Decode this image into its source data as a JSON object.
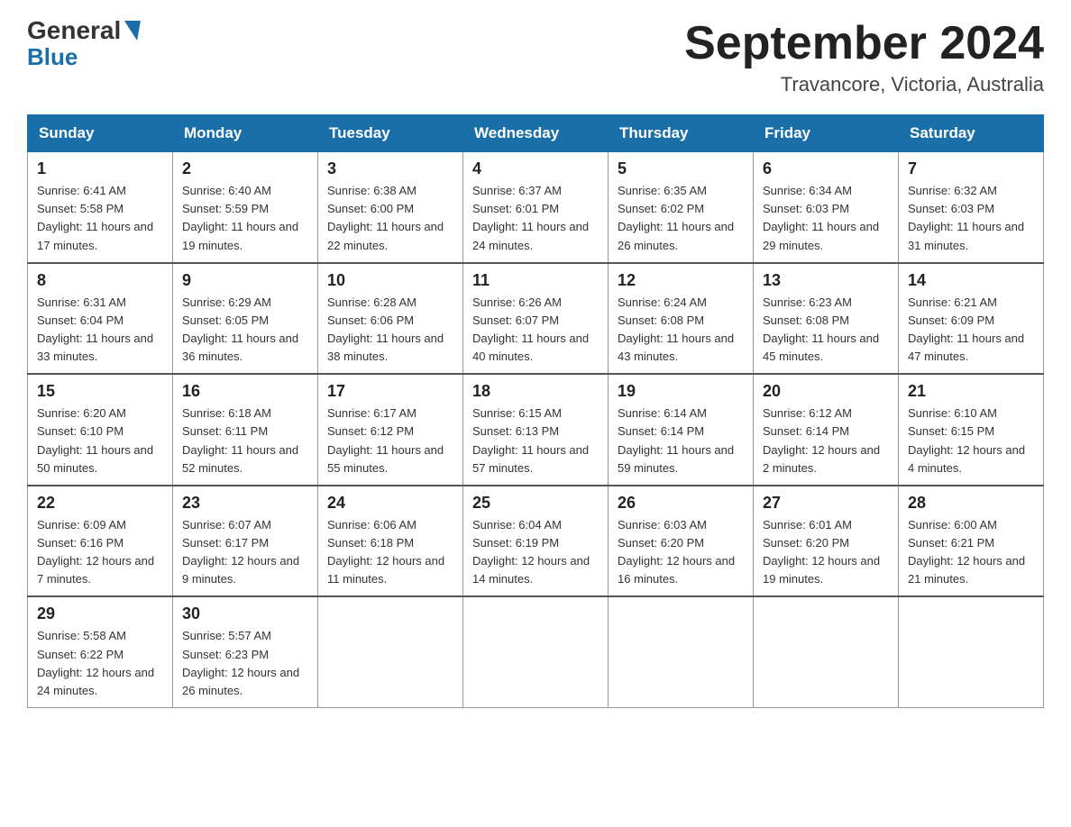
{
  "header": {
    "logo": {
      "general": "General",
      "blue": "Blue"
    },
    "title": "September 2024",
    "location": "Travancore, Victoria, Australia"
  },
  "weekdays": [
    "Sunday",
    "Monday",
    "Tuesday",
    "Wednesday",
    "Thursday",
    "Friday",
    "Saturday"
  ],
  "weeks": [
    [
      {
        "day": "1",
        "sunrise": "6:41 AM",
        "sunset": "5:58 PM",
        "daylight": "11 hours and 17 minutes."
      },
      {
        "day": "2",
        "sunrise": "6:40 AM",
        "sunset": "5:59 PM",
        "daylight": "11 hours and 19 minutes."
      },
      {
        "day": "3",
        "sunrise": "6:38 AM",
        "sunset": "6:00 PM",
        "daylight": "11 hours and 22 minutes."
      },
      {
        "day": "4",
        "sunrise": "6:37 AM",
        "sunset": "6:01 PM",
        "daylight": "11 hours and 24 minutes."
      },
      {
        "day": "5",
        "sunrise": "6:35 AM",
        "sunset": "6:02 PM",
        "daylight": "11 hours and 26 minutes."
      },
      {
        "day": "6",
        "sunrise": "6:34 AM",
        "sunset": "6:03 PM",
        "daylight": "11 hours and 29 minutes."
      },
      {
        "day": "7",
        "sunrise": "6:32 AM",
        "sunset": "6:03 PM",
        "daylight": "11 hours and 31 minutes."
      }
    ],
    [
      {
        "day": "8",
        "sunrise": "6:31 AM",
        "sunset": "6:04 PM",
        "daylight": "11 hours and 33 minutes."
      },
      {
        "day": "9",
        "sunrise": "6:29 AM",
        "sunset": "6:05 PM",
        "daylight": "11 hours and 36 minutes."
      },
      {
        "day": "10",
        "sunrise": "6:28 AM",
        "sunset": "6:06 PM",
        "daylight": "11 hours and 38 minutes."
      },
      {
        "day": "11",
        "sunrise": "6:26 AM",
        "sunset": "6:07 PM",
        "daylight": "11 hours and 40 minutes."
      },
      {
        "day": "12",
        "sunrise": "6:24 AM",
        "sunset": "6:08 PM",
        "daylight": "11 hours and 43 minutes."
      },
      {
        "day": "13",
        "sunrise": "6:23 AM",
        "sunset": "6:08 PM",
        "daylight": "11 hours and 45 minutes."
      },
      {
        "day": "14",
        "sunrise": "6:21 AM",
        "sunset": "6:09 PM",
        "daylight": "11 hours and 47 minutes."
      }
    ],
    [
      {
        "day": "15",
        "sunrise": "6:20 AM",
        "sunset": "6:10 PM",
        "daylight": "11 hours and 50 minutes."
      },
      {
        "day": "16",
        "sunrise": "6:18 AM",
        "sunset": "6:11 PM",
        "daylight": "11 hours and 52 minutes."
      },
      {
        "day": "17",
        "sunrise": "6:17 AM",
        "sunset": "6:12 PM",
        "daylight": "11 hours and 55 minutes."
      },
      {
        "day": "18",
        "sunrise": "6:15 AM",
        "sunset": "6:13 PM",
        "daylight": "11 hours and 57 minutes."
      },
      {
        "day": "19",
        "sunrise": "6:14 AM",
        "sunset": "6:14 PM",
        "daylight": "11 hours and 59 minutes."
      },
      {
        "day": "20",
        "sunrise": "6:12 AM",
        "sunset": "6:14 PM",
        "daylight": "12 hours and 2 minutes."
      },
      {
        "day": "21",
        "sunrise": "6:10 AM",
        "sunset": "6:15 PM",
        "daylight": "12 hours and 4 minutes."
      }
    ],
    [
      {
        "day": "22",
        "sunrise": "6:09 AM",
        "sunset": "6:16 PM",
        "daylight": "12 hours and 7 minutes."
      },
      {
        "day": "23",
        "sunrise": "6:07 AM",
        "sunset": "6:17 PM",
        "daylight": "12 hours and 9 minutes."
      },
      {
        "day": "24",
        "sunrise": "6:06 AM",
        "sunset": "6:18 PM",
        "daylight": "12 hours and 11 minutes."
      },
      {
        "day": "25",
        "sunrise": "6:04 AM",
        "sunset": "6:19 PM",
        "daylight": "12 hours and 14 minutes."
      },
      {
        "day": "26",
        "sunrise": "6:03 AM",
        "sunset": "6:20 PM",
        "daylight": "12 hours and 16 minutes."
      },
      {
        "day": "27",
        "sunrise": "6:01 AM",
        "sunset": "6:20 PM",
        "daylight": "12 hours and 19 minutes."
      },
      {
        "day": "28",
        "sunrise": "6:00 AM",
        "sunset": "6:21 PM",
        "daylight": "12 hours and 21 minutes."
      }
    ],
    [
      {
        "day": "29",
        "sunrise": "5:58 AM",
        "sunset": "6:22 PM",
        "daylight": "12 hours and 24 minutes."
      },
      {
        "day": "30",
        "sunrise": "5:57 AM",
        "sunset": "6:23 PM",
        "daylight": "12 hours and 26 minutes."
      },
      null,
      null,
      null,
      null,
      null
    ]
  ]
}
